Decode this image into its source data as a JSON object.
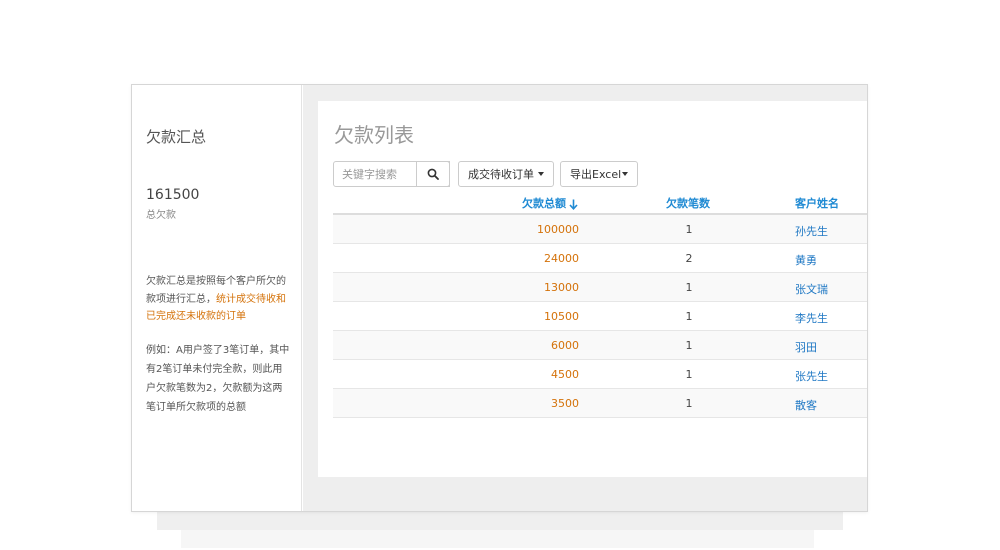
{
  "sidebar": {
    "title": "欠款汇总",
    "total_amount": "161500",
    "total_label": "总欠款",
    "desc_prefix": "欠款汇总是按照每个客户所欠的款项进行汇总，",
    "desc_highlight": "统计成交待收和已完成还未收款的订单",
    "example": "例如：A用户签了3笔订单，其中有2笔订单未付完全款，则此用户欠款笔数为2，欠款额为这两笔订单所欠款项的总额"
  },
  "main": {
    "title": "欠款列表",
    "search_placeholder": "关键字搜索",
    "filter_label": "成交待收订单",
    "export_label": "导出Excel"
  },
  "table": {
    "columns": [
      "欠款总额",
      "欠款笔数",
      "客户姓名"
    ],
    "rows": [
      {
        "amount": "100000",
        "count": "1",
        "name": "孙先生"
      },
      {
        "amount": "24000",
        "count": "2",
        "name": "黄勇"
      },
      {
        "amount": "13000",
        "count": "1",
        "name": "张文瑞"
      },
      {
        "amount": "10500",
        "count": "1",
        "name": "李先生"
      },
      {
        "amount": "6000",
        "count": "1",
        "name": "羽田"
      },
      {
        "amount": "4500",
        "count": "1",
        "name": "张先生"
      },
      {
        "amount": "3500",
        "count": "1",
        "name": "散客"
      }
    ]
  },
  "colors": {
    "accent_blue": "#1f8ad3",
    "amount_orange": "#d4720a",
    "link_blue": "#1f78c4"
  },
  "icons": {
    "search": "search-icon",
    "sort": "arrow-down-icon",
    "dropdown": "caret-down-icon"
  }
}
